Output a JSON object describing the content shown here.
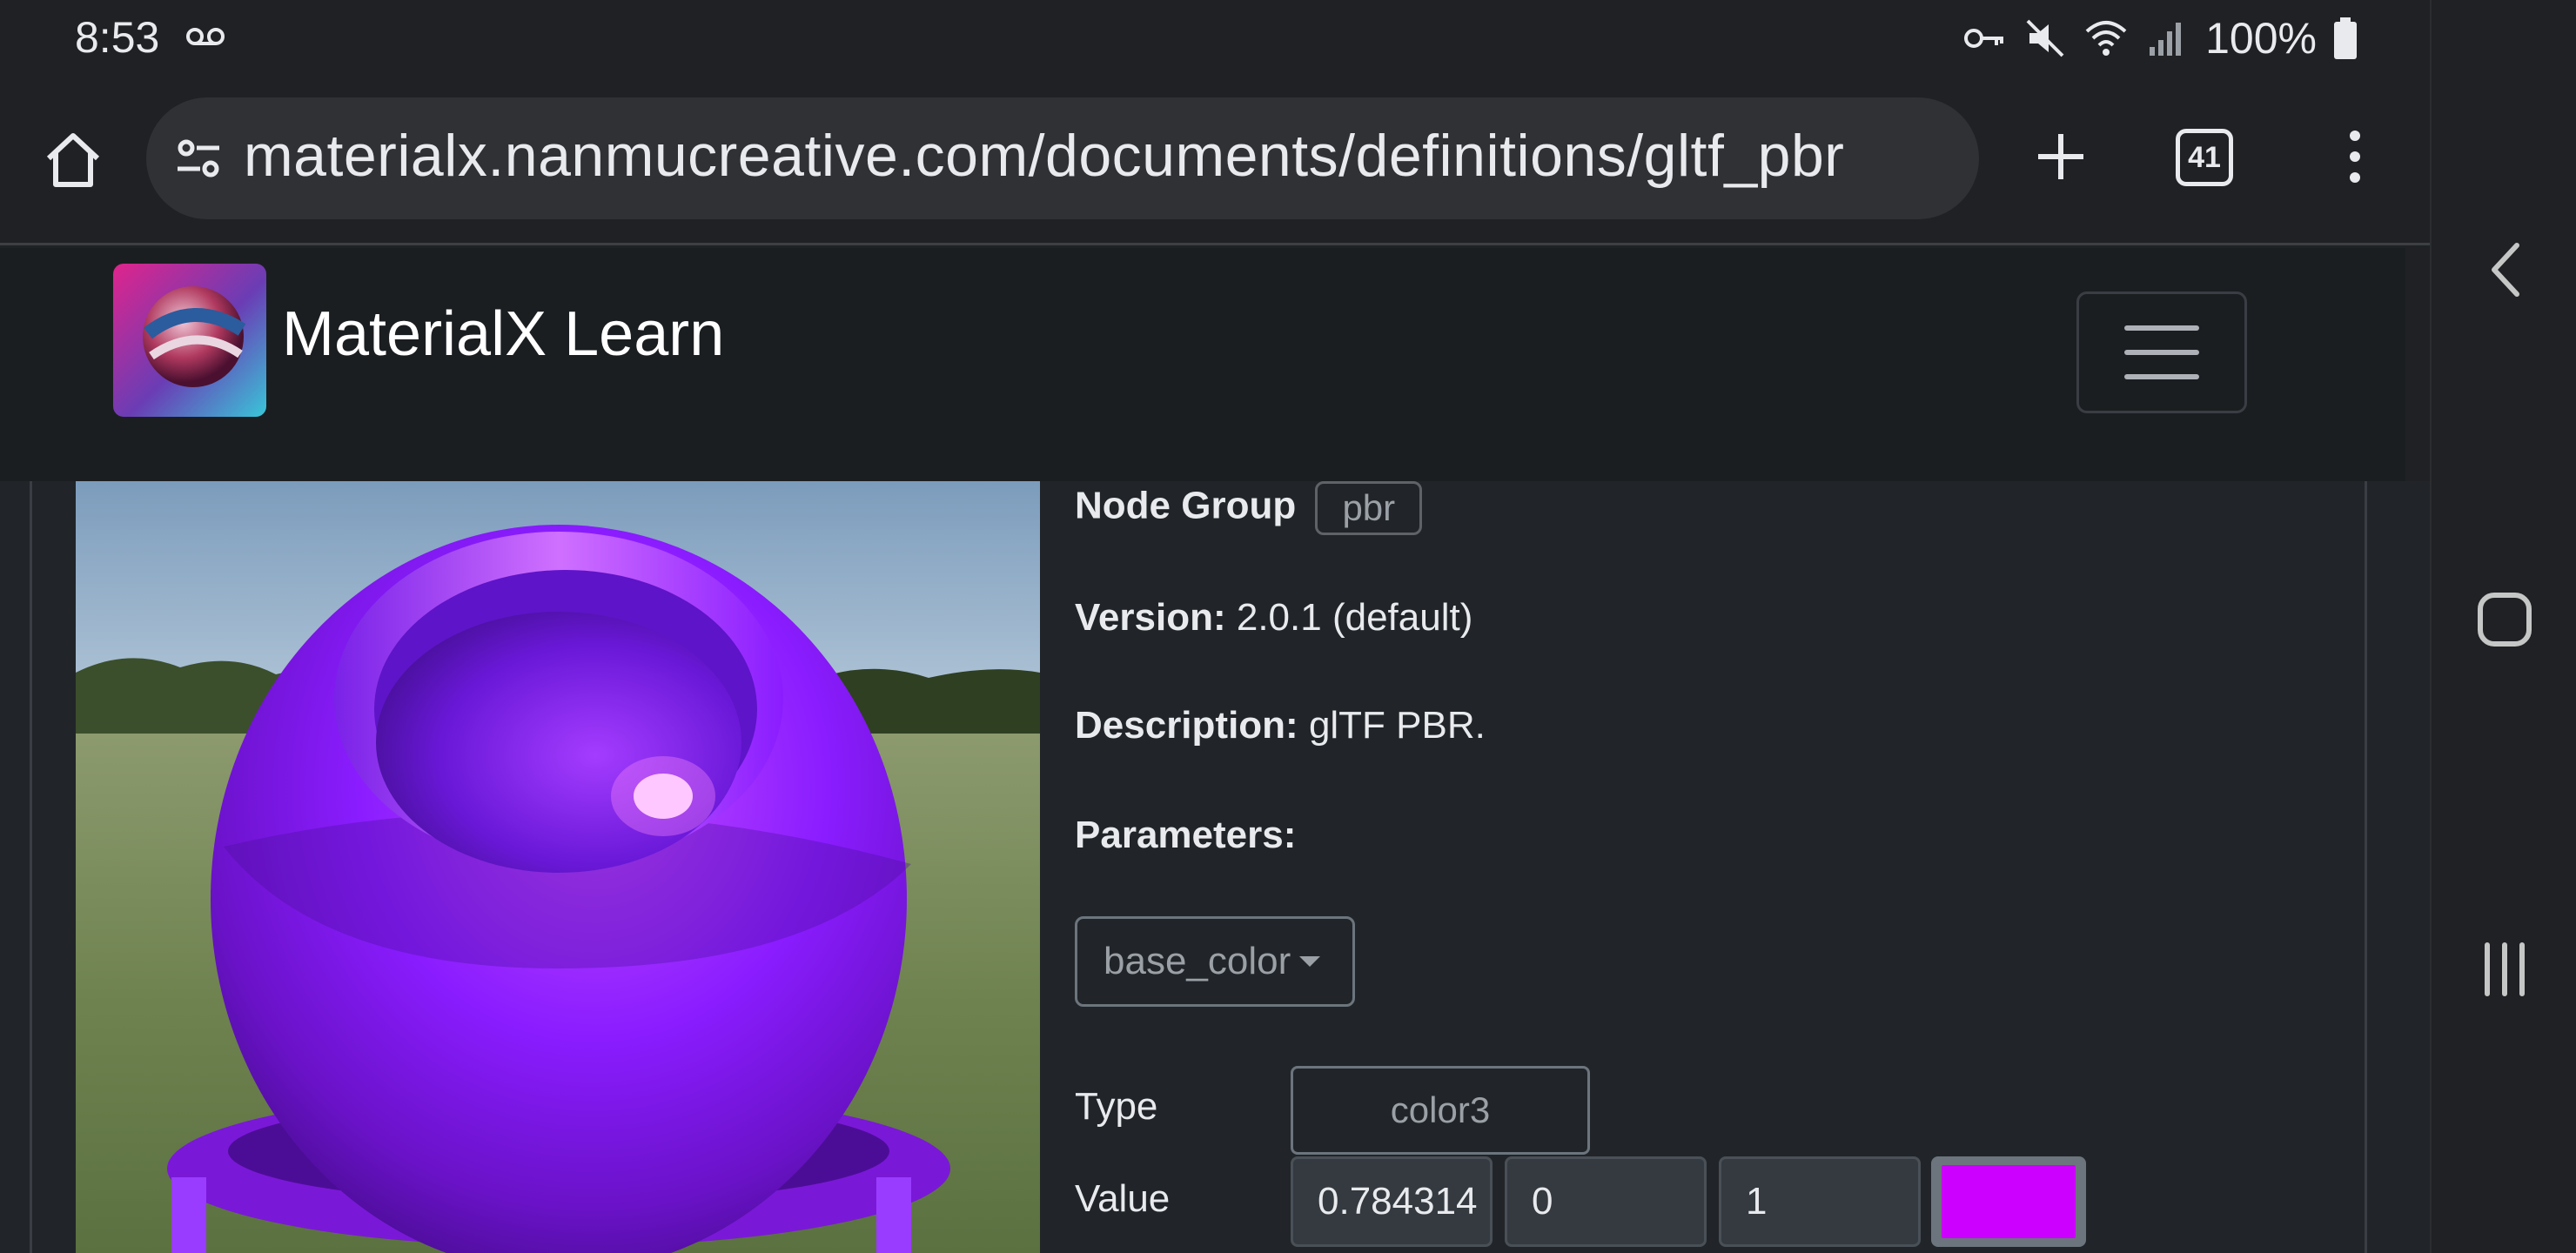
{
  "status_bar": {
    "time": "8:53",
    "battery": "100%",
    "icons": [
      "voicemail-icon",
      "vpn-key-icon",
      "mute-icon",
      "wifi-icon",
      "signal-icon",
      "battery-icon"
    ]
  },
  "browser": {
    "url": "materialx.nanmucreative.com/documents/definitions/gltf_pbr",
    "tab_count": "41",
    "icons": [
      "home-icon",
      "site-settings-icon",
      "new-tab-icon",
      "overflow-menu-icon"
    ]
  },
  "site": {
    "brand": "MaterialX Learn",
    "icons": [
      "logo-icon",
      "hamburger-menu-icon"
    ]
  },
  "definition": {
    "node_group_label": "Node Group",
    "node_group_value": "pbr",
    "version_label": "Version:",
    "version_value": "2.0.1 (default)",
    "description_label": "Description:",
    "description_value": "glTF PBR.",
    "parameters_label": "Parameters:",
    "parameter_selected": "base_color",
    "type_label": "Type",
    "type_value": "color3",
    "value_label": "Value",
    "value_r": "0.784314",
    "value_g": "0",
    "value_b": "1",
    "swatch_color": "#cc00ff"
  },
  "colors": {
    "page_bg": "#212529",
    "header_bg": "#1b1e21",
    "browser_bg": "#202124",
    "url_bg": "#303134",
    "material_purple": "#8a1cff"
  },
  "nav_bar": {
    "icons": [
      "back-icon",
      "home-square-icon",
      "recents-icon"
    ]
  }
}
